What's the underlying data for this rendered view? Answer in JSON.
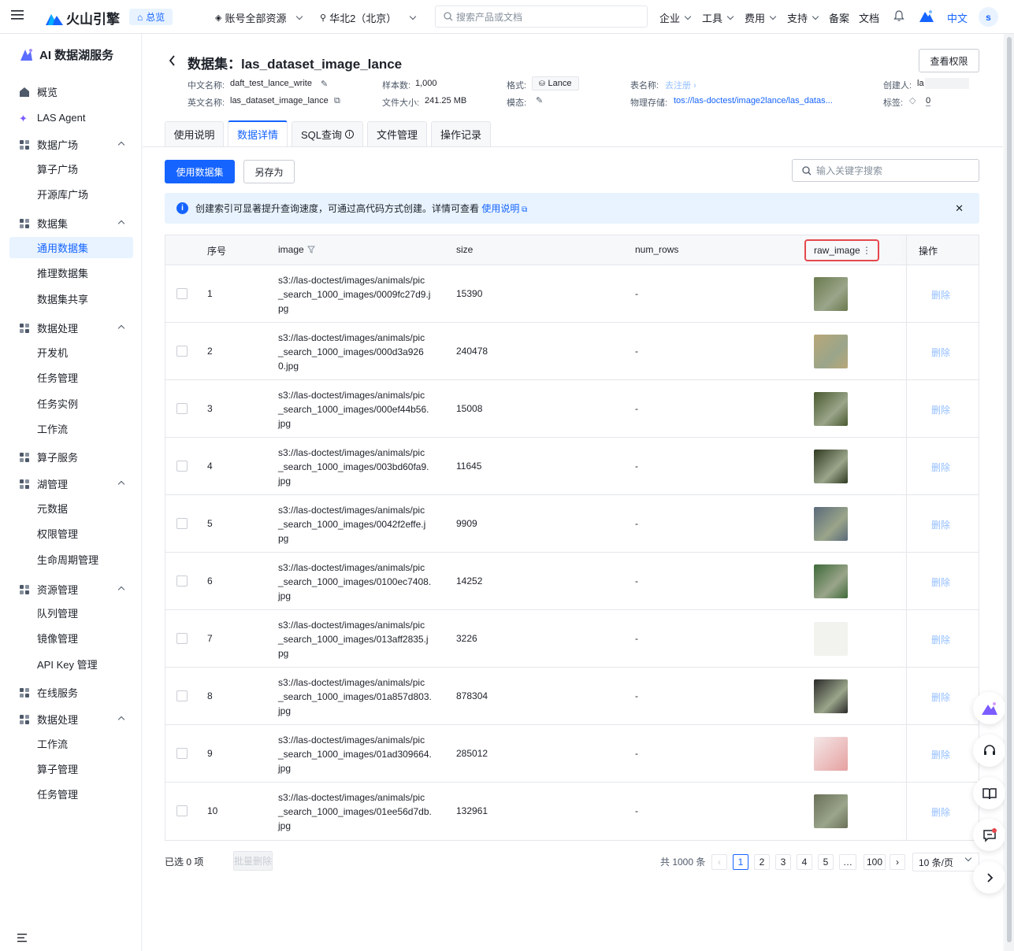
{
  "topbar": {
    "brand": "火山引擎",
    "overview": "总览",
    "account": "账号全部资源",
    "region": "华北2（北京）",
    "search_placeholder": "搜索产品或文档",
    "menu": [
      "企业",
      "工具",
      "费用",
      "支持"
    ],
    "links": [
      "备案",
      "文档"
    ],
    "lang": "中文",
    "avatar": "s"
  },
  "sidebar": {
    "title": "AI 数据湖服务",
    "items": [
      {
        "type": "group",
        "label": "概览",
        "icon": "home-icon"
      },
      {
        "type": "group",
        "label": "LAS Agent",
        "icon": "sparkle-icon"
      },
      {
        "type": "group",
        "label": "数据广场",
        "icon": "grid-icon",
        "expanded": true
      },
      {
        "type": "sub",
        "label": "算子广场"
      },
      {
        "type": "sub",
        "label": "开源库广场"
      },
      {
        "type": "group",
        "label": "数据集",
        "icon": "layers-icon",
        "expanded": true
      },
      {
        "type": "sub",
        "label": "通用数据集",
        "active": true
      },
      {
        "type": "sub",
        "label": "推理数据集"
      },
      {
        "type": "sub",
        "label": "数据集共享"
      },
      {
        "type": "group",
        "label": "数据处理",
        "icon": "process-icon",
        "expanded": true
      },
      {
        "type": "sub",
        "label": "开发机"
      },
      {
        "type": "sub",
        "label": "任务管理"
      },
      {
        "type": "sub",
        "label": "任务实例"
      },
      {
        "type": "sub",
        "label": "工作流"
      },
      {
        "type": "group",
        "label": "算子服务",
        "icon": "operator-icon"
      },
      {
        "type": "group",
        "label": "湖管理",
        "icon": "database-icon",
        "expanded": true
      },
      {
        "type": "sub",
        "label": "元数据"
      },
      {
        "type": "sub",
        "label": "权限管理"
      },
      {
        "type": "sub",
        "label": "生命周期管理"
      },
      {
        "type": "group",
        "label": "资源管理",
        "icon": "server-icon",
        "expanded": true
      },
      {
        "type": "sub",
        "label": "队列管理"
      },
      {
        "type": "sub",
        "label": "镜像管理"
      },
      {
        "type": "sub",
        "label": "API Key 管理"
      },
      {
        "type": "group",
        "label": "在线服务",
        "icon": "apps-icon"
      },
      {
        "type": "group",
        "label": "数据处理",
        "icon": "process-icon",
        "expanded": true
      },
      {
        "type": "sub",
        "label": "工作流"
      },
      {
        "type": "sub",
        "label": "算子管理"
      },
      {
        "type": "sub",
        "label": "任务管理"
      }
    ]
  },
  "header": {
    "title": "数据集：las_dataset_image_lance",
    "view_permission": "查看权限",
    "cn_name_label": "中文名称:",
    "cn_name": "daft_test_lance_write",
    "en_name_label": "英文名称:",
    "en_name": "las_dataset_image_lance",
    "samples_label": "样本数:",
    "samples": "1,000",
    "filesize_label": "文件大小:",
    "filesize": "241.25 MB",
    "format_label": "格式:",
    "format": "Lance",
    "modality_label": "模态:",
    "table_label": "表名称:",
    "table_action": "去注册",
    "storage_label": "物理存储:",
    "storage": "tos://las-doctest/image2lance/las_datas...",
    "creator_label": "创建人:",
    "creator": "la",
    "tags_label": "标签:",
    "tags_count": "0"
  },
  "tabs": [
    "使用说明",
    "数据详情",
    "SQL查询",
    "文件管理",
    "操作记录"
  ],
  "toolbar": {
    "use_dataset": "使用数据集",
    "save_as": "另存为",
    "search_placeholder": "输入关键字搜索"
  },
  "notice": {
    "text": "创建索引可显著提升查询速度，可通过高代码方式创建。详情可查看",
    "link": "使用说明"
  },
  "table": {
    "columns": [
      "序号",
      "image",
      "size",
      "num_rows",
      "raw_image",
      "操作"
    ],
    "rows": [
      {
        "idx": "1",
        "image": [
          "s3://las-doctest/images/animals/pic",
          "_search_1000_images/0009fc27d9.j",
          "pg"
        ],
        "size": "15390",
        "num_rows": "-",
        "action": "删除"
      },
      {
        "idx": "2",
        "image": [
          "s3://las-doctest/images/animals/pic",
          "_search_1000_images/000d3a926",
          "0.jpg"
        ],
        "size": "240478",
        "num_rows": "-",
        "action": "删除"
      },
      {
        "idx": "3",
        "image": [
          "s3://las-doctest/images/animals/pic",
          "_search_1000_images/000ef44b56.",
          "jpg"
        ],
        "size": "15008",
        "num_rows": "-",
        "action": "删除"
      },
      {
        "idx": "4",
        "image": [
          "s3://las-doctest/images/animals/pic",
          "_search_1000_images/003bd60fa9.",
          "jpg"
        ],
        "size": "11645",
        "num_rows": "-",
        "action": "删除"
      },
      {
        "idx": "5",
        "image": [
          "s3://las-doctest/images/animals/pic",
          "_search_1000_images/0042f2effe.j",
          "pg"
        ],
        "size": "9909",
        "num_rows": "-",
        "action": "删除"
      },
      {
        "idx": "6",
        "image": [
          "s3://las-doctest/images/animals/pic",
          "_search_1000_images/0100ec7408.",
          "jpg"
        ],
        "size": "14252",
        "num_rows": "-",
        "action": "删除"
      },
      {
        "idx": "7",
        "image": [
          "s3://las-doctest/images/animals/pic",
          "_search_1000_images/013aff2835.j",
          "pg"
        ],
        "size": "3226",
        "num_rows": "-",
        "action": "删除"
      },
      {
        "idx": "8",
        "image": [
          "s3://las-doctest/images/animals/pic",
          "_search_1000_images/01a857d803.",
          "jpg"
        ],
        "size": "878304",
        "num_rows": "-",
        "action": "删除"
      },
      {
        "idx": "9",
        "image": [
          "s3://las-doctest/images/animals/pic",
          "_search_1000_images/01ad309664.",
          "jpg"
        ],
        "size": "285012",
        "num_rows": "-",
        "action": "删除"
      },
      {
        "idx": "10",
        "image": [
          "s3://las-doctest/images/animals/pic",
          "_search_1000_images/01ee56d7db.",
          "jpg"
        ],
        "size": "132961",
        "num_rows": "-",
        "action": "删除"
      }
    ],
    "thumb_colors": [
      "#6b7a4e",
      "#b8a778",
      "#4a5a30",
      "#2f3a22",
      "#5a6a7a",
      "#3f6a3a",
      "#f2f2ee",
      "#2a2a2a",
      "#f4e8e8",
      "#6a7058"
    ]
  },
  "footer": {
    "selected": "已选 0 项",
    "batch_delete": "批量删除",
    "total": "共 1000 条",
    "pages": [
      "1",
      "2",
      "3",
      "4",
      "5",
      "…",
      "100"
    ],
    "page_size": "10 条/页"
  },
  "colors": {
    "accent": "#1664ff",
    "notice_bg": "#e8f3ff",
    "highlight_border": "#e5484d"
  }
}
